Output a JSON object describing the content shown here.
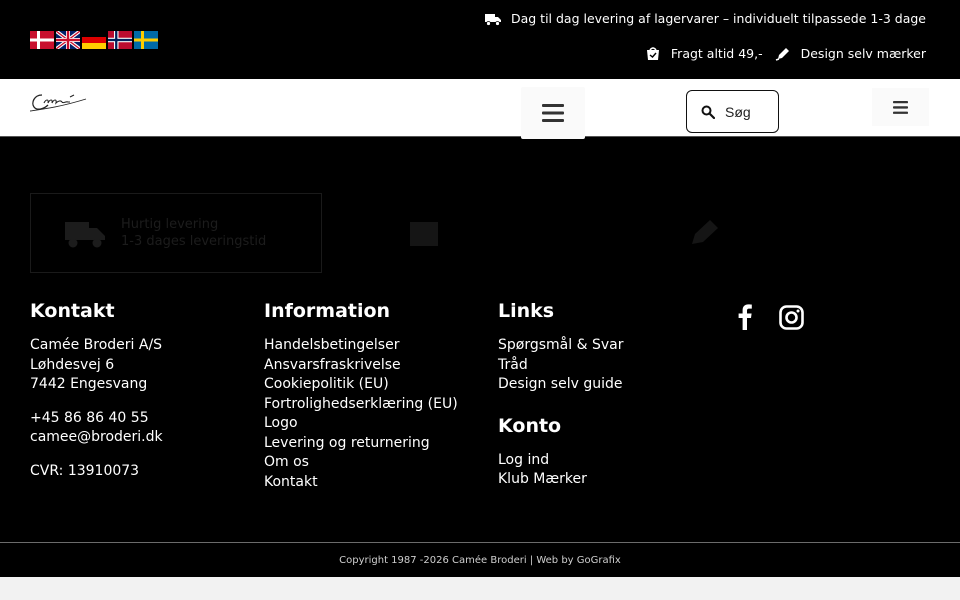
{
  "topbar": {
    "flags": [
      "flag-dk-icon",
      "flag-uk-icon",
      "flag-de-icon",
      "flag-no-icon",
      "flag-se-icon"
    ],
    "delivery_text": "Dag til dag levering af lagervarer – individuelt tilpassede 1-3 dage",
    "shipping_text": "Fragt altid 49,-",
    "design_text": "Design selv mærker"
  },
  "header": {
    "logo_alt": "Camée",
    "search_placeholder": "Søg"
  },
  "features": [
    {
      "icon": "truck-icon",
      "line1": "Hurtig levering",
      "line2": "1-3 dages leveringstid"
    },
    {
      "icon": "box-icon",
      "line1": "",
      "line2": ""
    },
    {
      "icon": "pen-icon",
      "line1": "",
      "line2": ""
    }
  ],
  "footer": {
    "kontakt": {
      "title": "Kontakt",
      "company": "Camée Broderi A/S",
      "street": "Løhdesvej 6",
      "city": "7442 Engesvang",
      "phone": "+45 86 86 40 55",
      "email": "camee@broderi.dk",
      "cvr": "CVR: 13910073"
    },
    "information": {
      "title": "Information",
      "links": [
        "Handelsbetingelser",
        "Ansvarsfraskrivelse",
        "Cookiepolitik (EU)",
        "Fortrolighedserklæring (EU)",
        "Logo",
        "Levering og returnering",
        "Om os",
        "Kontakt"
      ]
    },
    "links": {
      "title": "Links",
      "links": [
        "Spørgsmål & Svar",
        "Tråd",
        "Design selv guide"
      ]
    },
    "konto": {
      "title": "Konto",
      "links": [
        "Log ind",
        "Klub Mærker"
      ]
    },
    "social": [
      "facebook-icon",
      "instagram-icon"
    ]
  },
  "copyright": {
    "text": "Copyright 1987 -2026 Camée Broderi | Web by ",
    "link": "GoGrafix"
  },
  "colors": {
    "background": "#000000",
    "header_bg": "#ffffff",
    "text": "#ffffff"
  }
}
